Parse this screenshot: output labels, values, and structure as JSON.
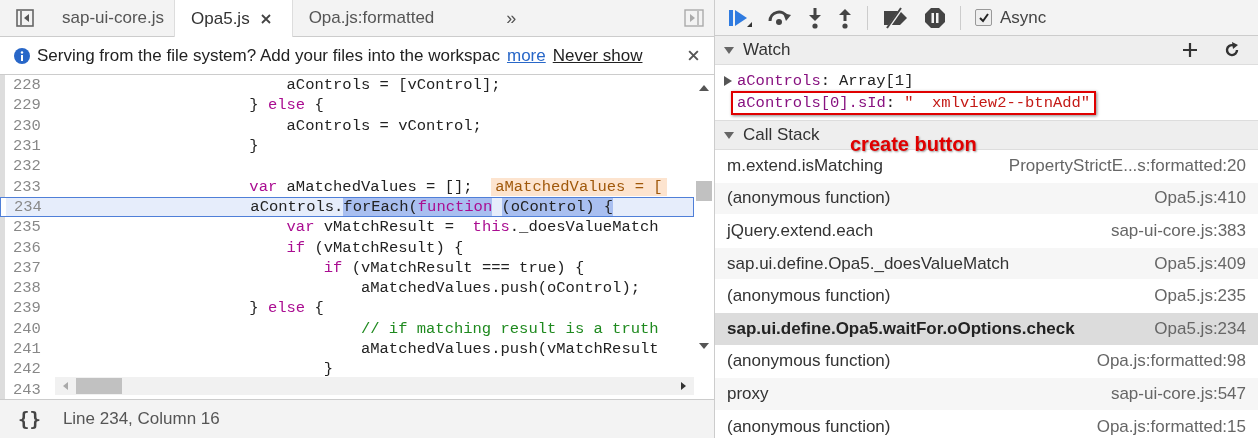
{
  "editor_tabs": [
    {
      "label": "sap-ui-core.js",
      "selected": false
    },
    {
      "label": "Opa5.js",
      "selected": true
    },
    {
      "label": "Opa.js:formatted",
      "selected": false
    }
  ],
  "tabs_overflow": "»",
  "infobar": {
    "message": "Serving from the file system? Add your files into the workspac",
    "links": [
      "more",
      "Never show"
    ]
  },
  "code_lines": [
    {
      "number": "228",
      "current": false,
      "tokens": [
        {
          "kind": "plain",
          "text": "                         aControls = [vControl];"
        }
      ]
    },
    {
      "number": "229",
      "current": false,
      "tokens": [
        {
          "kind": "plain",
          "text": "                     } "
        },
        {
          "kind": "keyword",
          "text": "else"
        },
        {
          "kind": "plain",
          "text": " {"
        }
      ]
    },
    {
      "number": "230",
      "current": false,
      "tokens": [
        {
          "kind": "plain",
          "text": "                         aControls = vControl;"
        }
      ]
    },
    {
      "number": "231",
      "current": false,
      "tokens": [
        {
          "kind": "plain",
          "text": "                     }"
        }
      ]
    },
    {
      "number": "232",
      "current": false
    },
    {
      "number": "233",
      "current": false,
      "tokens": [
        {
          "kind": "keyword",
          "text": "                     var"
        },
        {
          "kind": "plain",
          "text": " aMatchedValues = [];  "
        },
        {
          "kind": "inline-value",
          "text": "aMatchedValues = ["
        }
      ]
    },
    {
      "number": "234",
      "current": true,
      "tokens": [
        {
          "kind": "plain",
          "text": "                     aControls.",
          "highlighted": false
        },
        {
          "kind": "plain",
          "text": "forEach(",
          "highlighted": true
        },
        {
          "kind": "keyword",
          "text": "function",
          "highlighted": true
        },
        {
          "kind": "plain",
          "text": " (oControl) {",
          "highlighted": true
        }
      ]
    },
    {
      "number": "235",
      "current": false,
      "tokens": [
        {
          "kind": "keyword",
          "text": "                         var"
        },
        {
          "kind": "plain",
          "text": " vMatchResult =  "
        },
        {
          "kind": "keyword",
          "text": "this"
        },
        {
          "kind": "plain",
          "text": "._doesValueMatch"
        }
      ]
    },
    {
      "number": "236",
      "current": false,
      "tokens": [
        {
          "kind": "keyword",
          "text": "                         if"
        },
        {
          "kind": "plain",
          "text": " (vMatchResult) {"
        }
      ]
    },
    {
      "number": "237",
      "current": false,
      "tokens": [
        {
          "kind": "keyword",
          "text": "                             if"
        },
        {
          "kind": "plain",
          "text": " (vMatchResult === true) {"
        }
      ]
    },
    {
      "number": "238",
      "current": false,
      "tokens": [
        {
          "kind": "plain",
          "text": "                                 aMatchedValues.push(oControl);"
        }
      ]
    },
    {
      "number": "239",
      "current": false,
      "tokens": [
        {
          "kind": "plain",
          "text": "                     } "
        },
        {
          "kind": "keyword",
          "text": "else"
        },
        {
          "kind": "plain",
          "text": " {"
        }
      ]
    },
    {
      "number": "240",
      "current": false,
      "tokens": [
        {
          "kind": "comment",
          "text": "                                 // if matching result is a truth"
        }
      ]
    },
    {
      "number": "241",
      "current": false,
      "tokens": [
        {
          "kind": "plain",
          "text": "                                 aMatchedValues.push(vMatchResult"
        }
      ]
    },
    {
      "number": "242",
      "current": false,
      "tokens": [
        {
          "kind": "plain",
          "text": "                             }"
        }
      ]
    },
    {
      "number": "243",
      "current": false
    }
  ],
  "status_bar": {
    "pretty_print": "{}",
    "position": "Line 234, Column 16"
  },
  "debugger_toolbar": {
    "async": {
      "label": "Async",
      "checked": true
    }
  },
  "watch": {
    "title": "Watch",
    "expanded": true,
    "entries": [
      {
        "kind": "object",
        "name": "aControls",
        "separator": ":",
        "value": "Array[1]",
        "expanded": false,
        "annotated": false
      },
      {
        "kind": "string",
        "name": "aControls[0].sId",
        "separator": ":",
        "value": "\"  xmlview2--btnAdd\"",
        "annotated": true
      }
    ]
  },
  "call_stack": {
    "title": "Call Stack",
    "expanded": true,
    "annotation": "create button",
    "frames": [
      {
        "function": "m.extend.isMatching",
        "location": "PropertyStrictE...s:formatted:20",
        "selected": false
      },
      {
        "function": "(anonymous function)",
        "location": "Opa5.js:410",
        "selected": false
      },
      {
        "function": "jQuery.extend.each",
        "location": "sap-ui-core.js:383",
        "selected": false
      },
      {
        "function": "sap.ui.define.Opa5._doesValueMatch",
        "location": "Opa5.js:409",
        "selected": false
      },
      {
        "function": "(anonymous function)",
        "location": "Opa5.js:235",
        "selected": false
      },
      {
        "function": "sap.ui.define.Opa5.waitFor.oOptions.check",
        "location": "Opa5.js:234",
        "selected": true
      },
      {
        "function": "(anonymous function)",
        "location": "Opa.js:formatted:98",
        "selected": false
      },
      {
        "function": "proxy",
        "location": "sap-ui-core.js:547",
        "selected": false
      },
      {
        "function": "(anonymous function)",
        "location": "Opa.js:formatted:15",
        "selected": false
      }
    ]
  }
}
